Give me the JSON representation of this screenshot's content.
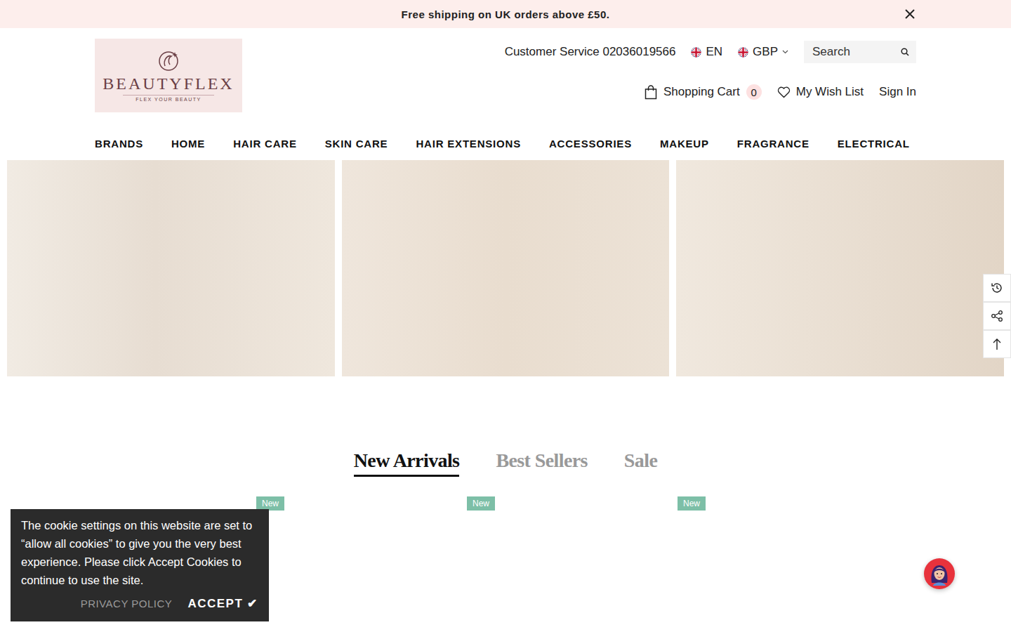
{
  "announcement": {
    "text": "Free shipping on UK orders above £50."
  },
  "logo": {
    "name": "BEAUTYFLEX",
    "tagline": "FLEX YOUR BEAUTY"
  },
  "header": {
    "customer_service": "Customer Service 02036019566",
    "language": "EN",
    "currency": "GBP",
    "cart": {
      "label": "Shopping Cart",
      "count": "0"
    },
    "wishlist": "My Wish List",
    "sign_in": "Sign In"
  },
  "search": {
    "placeholder": "Search"
  },
  "nav": [
    "BRANDS",
    "HOME",
    "HAIR CARE",
    "SKIN CARE",
    "HAIR EXTENSIONS",
    "ACCESSORIES",
    "MAKEUP",
    "FRAGRANCE",
    "ELECTRICAL"
  ],
  "tabs": [
    {
      "label": "New Arrivals",
      "selected": true
    },
    {
      "label": "Best Sellers",
      "selected": false
    },
    {
      "label": "Sale",
      "selected": false
    }
  ],
  "products": [
    {
      "badge": "New"
    },
    {
      "badge": "New"
    },
    {
      "badge": "New"
    }
  ],
  "cookie": {
    "message": "The cookie settings on this website are set to “allow all cookies” to give you the very best experience. Please click Accept Cookies to continue to use the site.",
    "privacy": "PRIVACY POLICY",
    "accept": "ACCEPT ✔"
  }
}
